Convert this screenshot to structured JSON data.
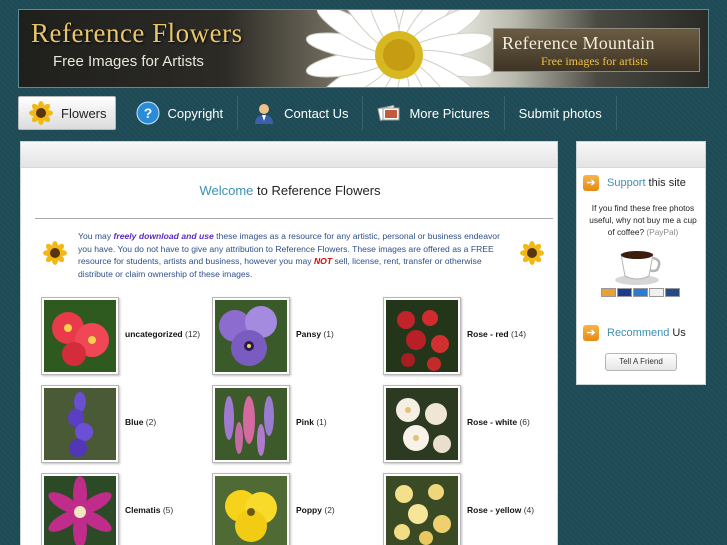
{
  "banner": {
    "title": "Reference Flowers",
    "subtitle": "Free Images for Artists",
    "mountain_title": "Reference Mountain",
    "mountain_subtitle": "Free images for artists"
  },
  "nav": {
    "items": [
      {
        "label": "Flowers",
        "icon": "sunflower-icon",
        "active": true
      },
      {
        "label": "Copyright",
        "icon": "help-icon"
      },
      {
        "label": "Contact Us",
        "icon": "person-icon"
      },
      {
        "label": "More Pictures",
        "icon": "photos-icon"
      },
      {
        "label": "Submit photos"
      }
    ]
  },
  "main": {
    "welcome_lead": "Welcome",
    "welcome_rest": " to Reference Flowers",
    "intro": {
      "p1": "You may ",
      "em": "freely download and use",
      "p2": " these images as a resource for any artistic, personal or business endeavor you have. You do not have to give any attribution to Reference Flowers. These images are offered as a FREE resource for students, artists and business, however you may ",
      "strong": "NOT",
      "p3": " sell, license, rent, transfer or otherwise distribute or claim ownership of these images."
    },
    "categories": [
      {
        "name": "uncategorized",
        "count": "(12)"
      },
      {
        "name": "Pansy",
        "count": "(1)"
      },
      {
        "name": "Rose - red",
        "count": "(14)"
      },
      {
        "name": "Blue",
        "count": "(2)"
      },
      {
        "name": "Pink",
        "count": "(1)"
      },
      {
        "name": "Rose - white",
        "count": "(6)"
      },
      {
        "name": "Clematis",
        "count": "(5)"
      },
      {
        "name": "Poppy",
        "count": "(2)"
      },
      {
        "name": "Rose - yellow",
        "count": "(4)"
      }
    ]
  },
  "sidebar": {
    "support_accent": "Support",
    "support_rest": "this site",
    "support_text": "If you find these free photos useful, why not buy me a cup of coffee?",
    "paypal": "(PayPal)",
    "recommend_accent": "Recommend",
    "recommend_rest": "Us",
    "tell_button": "Tell A Friend"
  },
  "colors": {
    "background": "#1d4a55",
    "accent": "#3b8fb4",
    "banner_gold": "#e8c46a"
  }
}
